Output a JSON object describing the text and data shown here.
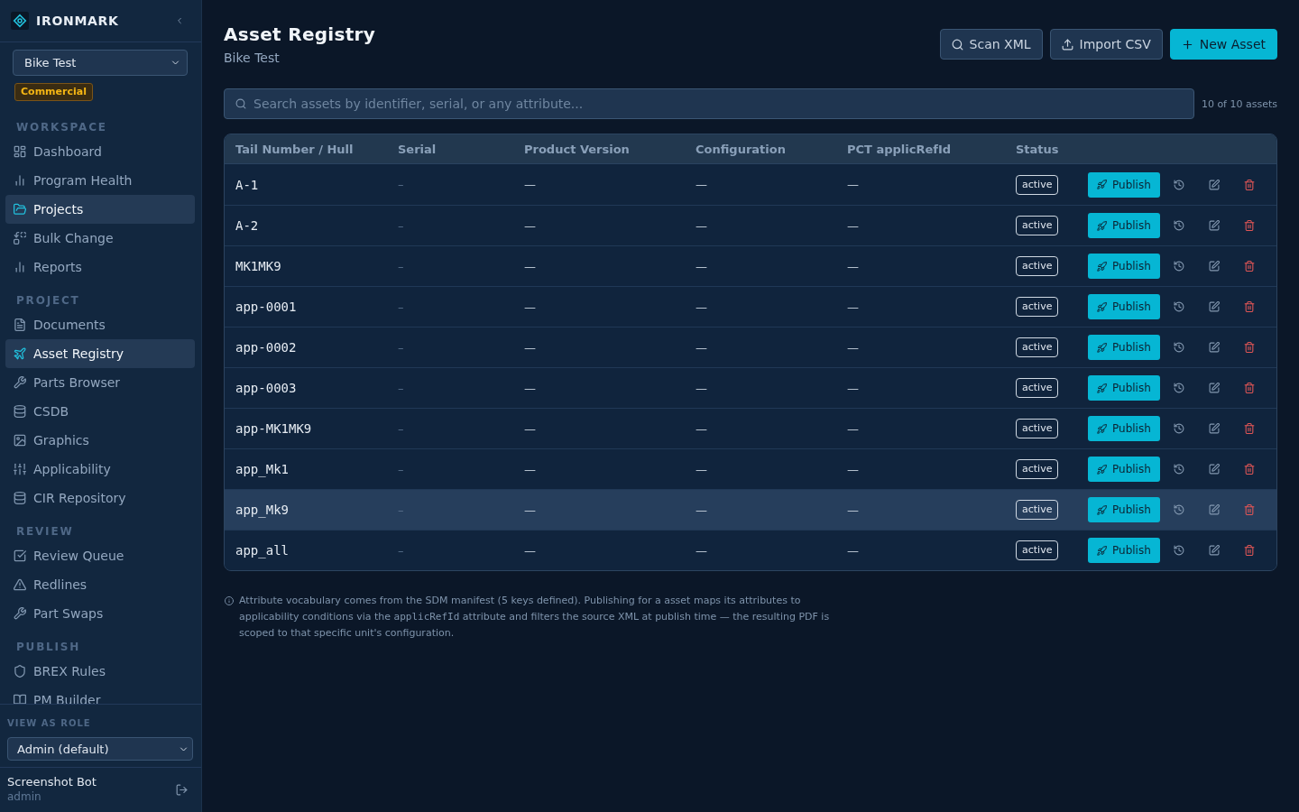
{
  "sidebar": {
    "brand": "IRONMARK",
    "project_select": {
      "value": "Bike Test"
    },
    "badge": "Commercial",
    "sections": [
      {
        "title": "WORKSPACE",
        "items": [
          {
            "label": "Dashboard",
            "selected": false
          },
          {
            "label": "Program Health",
            "selected": false
          },
          {
            "label": "Projects",
            "selected": true
          },
          {
            "label": "Bulk Change",
            "selected": false
          },
          {
            "label": "Reports",
            "selected": false
          }
        ]
      },
      {
        "title": "PROJECT",
        "items": [
          {
            "label": "Documents",
            "selected": false
          },
          {
            "label": "Asset Registry",
            "selected": true
          },
          {
            "label": "Parts Browser",
            "selected": false
          },
          {
            "label": "CSDB",
            "selected": false
          },
          {
            "label": "Graphics",
            "selected": false
          },
          {
            "label": "Applicability",
            "selected": false
          },
          {
            "label": "CIR Repository",
            "selected": false
          }
        ]
      },
      {
        "title": "REVIEW",
        "items": [
          {
            "label": "Review Queue",
            "selected": false
          },
          {
            "label": "Redlines",
            "selected": false
          },
          {
            "label": "Part Swaps",
            "selected": false
          }
        ]
      },
      {
        "title": "PUBLISH",
        "items": [
          {
            "label": "BREX Rules",
            "selected": false
          },
          {
            "label": "PM Builder",
            "selected": false
          }
        ]
      }
    ],
    "role": {
      "label": "VIEW AS ROLE",
      "value": "Admin (default)"
    },
    "user": {
      "name": "Screenshot Bot",
      "role": "admin"
    }
  },
  "header": {
    "title": "Asset Registry",
    "subtitle": "Bike Test",
    "buttons": [
      {
        "label": "Scan XML",
        "kind": "scan"
      },
      {
        "label": "Import CSV",
        "kind": "import"
      },
      {
        "label": "New Asset",
        "kind": "create"
      }
    ]
  },
  "search": {
    "placeholder": "Search assets by identifier, serial, or any attribute...",
    "count": "10 of 10 assets"
  },
  "table": {
    "columns": [
      "Tail Number / Hull",
      "Serial",
      "Product Version",
      "Configuration",
      "PCT applicRefId",
      "Status"
    ],
    "rows": [
      {
        "tail_number": "A-1",
        "serial": "–",
        "product_version": "—",
        "configuration": "—",
        "pct_applicrefid": "—",
        "status": "active",
        "publish": "Publish",
        "highlighted": false
      },
      {
        "tail_number": "A-2",
        "serial": "–",
        "product_version": "—",
        "configuration": "—",
        "pct_applicrefid": "—",
        "status": "active",
        "publish": "Publish",
        "highlighted": false
      },
      {
        "tail_number": "MK1MK9",
        "serial": "–",
        "product_version": "—",
        "configuration": "—",
        "pct_applicrefid": "—",
        "status": "active",
        "publish": "Publish",
        "highlighted": false
      },
      {
        "tail_number": "app-0001",
        "serial": "–",
        "product_version": "—",
        "configuration": "—",
        "pct_applicrefid": "—",
        "status": "active",
        "publish": "Publish",
        "highlighted": false
      },
      {
        "tail_number": "app-0002",
        "serial": "–",
        "product_version": "—",
        "configuration": "—",
        "pct_applicrefid": "—",
        "status": "active",
        "publish": "Publish",
        "highlighted": false
      },
      {
        "tail_number": "app-0003",
        "serial": "–",
        "product_version": "—",
        "configuration": "—",
        "pct_applicrefid": "—",
        "status": "active",
        "publish": "Publish",
        "highlighted": false
      },
      {
        "tail_number": "app-MK1MK9",
        "serial": "–",
        "product_version": "—",
        "configuration": "—",
        "pct_applicrefid": "—",
        "status": "active",
        "publish": "Publish",
        "highlighted": false
      },
      {
        "tail_number": "app_Mk1",
        "serial": "–",
        "product_version": "—",
        "configuration": "—",
        "pct_applicrefid": "—",
        "status": "active",
        "publish": "Publish",
        "highlighted": false
      },
      {
        "tail_number": "app_Mk9",
        "serial": "–",
        "product_version": "—",
        "configuration": "—",
        "pct_applicrefid": "—",
        "status": "active",
        "publish": "Publish",
        "highlighted": true
      },
      {
        "tail_number": "app_all",
        "serial": "–",
        "product_version": "—",
        "configuration": "—",
        "pct_applicrefid": "—",
        "status": "active",
        "publish": "Publish",
        "highlighted": false
      }
    ]
  },
  "note": {
    "parts": [
      {
        "kind": "text",
        "text": "Attribute vocabulary comes from the SDM manifest (5 keys defined). Publishing for a asset maps its attributes to applicability conditions via the "
      },
      {
        "kind": "code",
        "text": "applicRefId"
      },
      {
        "kind": "text",
        "text": " attribute and filters the source XML at publish time — the resulting PDF is scoped to that specific unit's configuration."
      }
    ]
  }
}
